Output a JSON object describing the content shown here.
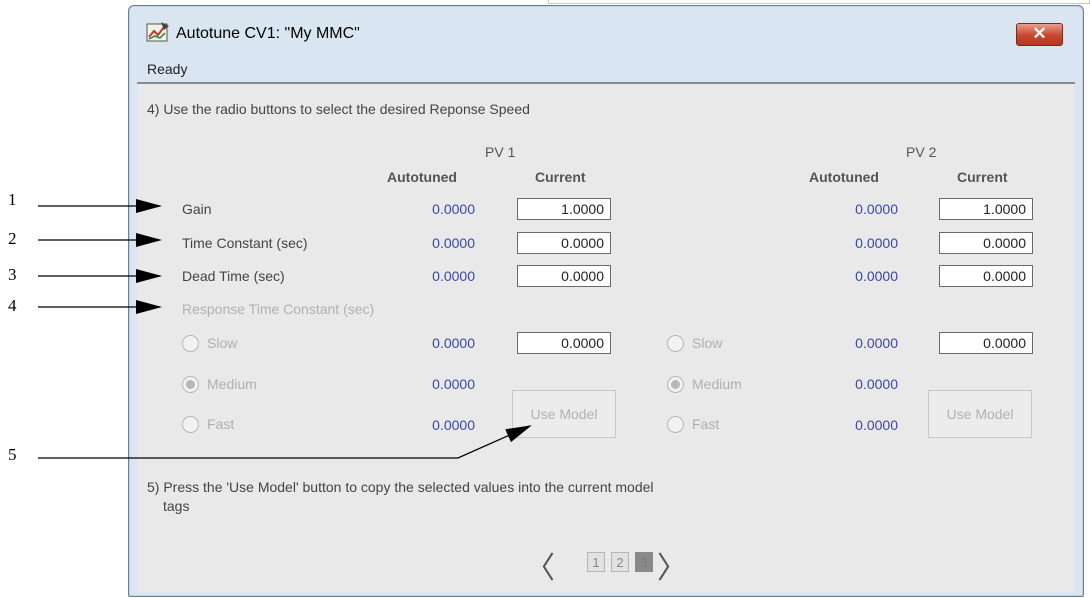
{
  "window": {
    "title": "Autotune CV1:  \"My MMC\"",
    "status": "Ready",
    "close_symbol": "✕"
  },
  "step4": "4) Use the radio buttons to select the desired Reponse Speed",
  "pv1": {
    "title": "PV 1",
    "col_autotuned": "Autotuned",
    "col_current": "Current"
  },
  "pv2": {
    "title": "PV 2",
    "col_autotuned": "Autotuned",
    "col_current": "Current"
  },
  "rows": [
    {
      "label": "Gain",
      "pv1_autotuned": "0.0000",
      "pv1_current": "1.0000",
      "pv2_autotuned": "0.0000",
      "pv2_current": "1.0000"
    },
    {
      "label": "Time Constant (sec)",
      "pv1_autotuned": "0.0000",
      "pv1_current": "0.0000",
      "pv2_autotuned": "0.0000",
      "pv2_current": "0.0000"
    },
    {
      "label": "Dead Time (sec)",
      "pv1_autotuned": "0.0000",
      "pv1_current": "0.0000",
      "pv2_autotuned": "0.0000",
      "pv2_current": "0.0000"
    }
  ],
  "response_label": "Response Time Constant (sec)",
  "response": {
    "pv1": [
      {
        "label": "Slow",
        "value": "0.0000",
        "current": "0.0000"
      },
      {
        "label": "Medium",
        "value": "0.0000",
        "selected": true
      },
      {
        "label": "Fast",
        "value": "0.0000"
      }
    ],
    "pv2": [
      {
        "label": "Slow",
        "value": "0.0000",
        "current": "0.0000"
      },
      {
        "label": "Medium",
        "value": "0.0000",
        "selected": true
      },
      {
        "label": "Fast",
        "value": "0.0000"
      }
    ]
  },
  "use_model_label": "Use Model",
  "step5": "5) Press the 'Use Model' button to copy the selected values into the current model",
  "step5_cont": "tags",
  "pager": {
    "pages": [
      "1",
      "2",
      "3"
    ],
    "current": "3",
    "prev": "〈",
    "next": "〉"
  },
  "callouts": [
    "1",
    "2",
    "3",
    "4",
    "5"
  ]
}
